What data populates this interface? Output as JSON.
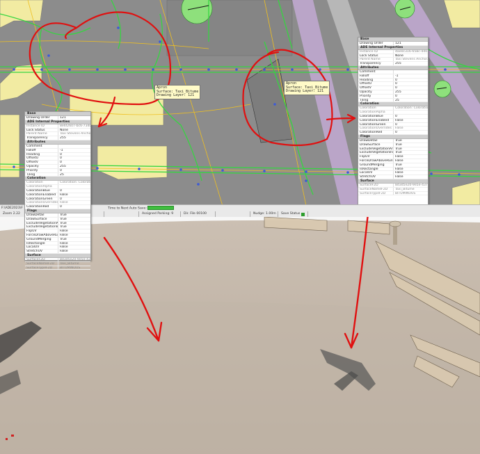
{
  "map_labels": {
    "left": {
      "line1": "Apron",
      "line2": "Surface: Taxi_Bitume",
      "line3": "Drawing Layer: 121"
    },
    "right": {
      "line1": "Apron",
      "line2": "Surface: Taxi_Bitume",
      "line3": "Drawing Layer: 121"
    }
  },
  "left_panel": {
    "rows": [
      {
        "type": "section",
        "label": "Base"
      },
      {
        "k": "Drawing Order",
        "v": "121"
      },
      {
        "type": "section",
        "label": "ADE Internal Properties"
      },
      {
        "k": "Instance ID",
        "v": "8e6f2607-bc6-7340a...",
        "gray": true
      },
      {
        "k": "Lock Status",
        "v": "None"
      },
      {
        "k": "Parent Name",
        "v": "Taxi Stevens Anchor...",
        "gray": true
      },
      {
        "k": "Transparency",
        "v": "255"
      },
      {
        "type": "section",
        "label": "Attributes"
      },
      {
        "k": "Comment",
        "v": ""
      },
      {
        "k": "Falloff",
        "v": "-1"
      },
      {
        "k": "Heading",
        "v": "0"
      },
      {
        "k": "OffsetU",
        "v": "0"
      },
      {
        "k": "OffsetV",
        "v": "0"
      },
      {
        "k": "Opacity",
        "v": "255"
      },
      {
        "k": "Priority",
        "v": "0"
      },
      {
        "k": "Tiling",
        "v": "25"
      },
      {
        "type": "section",
        "label": "Coloration"
      },
      {
        "k": "Coloration",
        "v": "Coloration: Coloration",
        "gray": true
      },
      {
        "k": "ColorationAlpha",
        "v": "",
        "gray": true
      },
      {
        "k": "ColorationBlue",
        "v": "0"
      },
      {
        "k": "ColorationEnabled",
        "v": "False"
      },
      {
        "k": "ColorationGreen",
        "v": "0"
      },
      {
        "k": "ColorationOverrides",
        "v": "False",
        "gray": true
      },
      {
        "k": "ColorationRed",
        "v": "0"
      },
      {
        "type": "section",
        "label": "Flags"
      },
      {
        "k": "DrawDetail",
        "v": "True"
      },
      {
        "k": "DrawSurface",
        "v": "True"
      },
      {
        "k": "ExcludeVegetationArou...",
        "v": "True"
      },
      {
        "k": "ExcludeVegetationInside",
        "v": "True"
      },
      {
        "k": "FlipUV",
        "v": "False"
      },
      {
        "k": "ForceDrawAboveRunway",
        "v": "False"
      },
      {
        "k": "GroundMerging",
        "v": "True"
      },
      {
        "k": "IsRectangle",
        "v": "False"
      },
      {
        "k": "LocalUV",
        "v": "False"
      },
      {
        "k": "StretchUV",
        "v": "False"
      },
      {
        "type": "section",
        "label": "Surface"
      },
      {
        "k": "SurfaceF2D",
        "v": "8d3d5e20-9e5e-437...",
        "gray": true
      },
      {
        "k": "SurfaceNameF2D",
        "v": "Taxi_Bitume",
        "gray": true
      },
      {
        "k": "SurfaceTypeF2D",
        "v": "BITUMINOUS",
        "gray": true
      }
    ]
  },
  "right_panel": {
    "rows": [
      {
        "type": "section",
        "label": "Base"
      },
      {
        "k": "Drawing Order",
        "v": "121"
      },
      {
        "type": "section",
        "label": "ADE Internal Properties"
      },
      {
        "k": "Instance ID",
        "v": "4ae0c316-658c-440...",
        "gray": true
      },
      {
        "k": "Lock Status",
        "v": "None"
      },
      {
        "k": "Parent Name",
        "v": "Taxi Stevens Anchor...",
        "gray": true
      },
      {
        "k": "Transparency",
        "v": "255"
      },
      {
        "type": "section",
        "label": "Attributes"
      },
      {
        "k": "Comment",
        "v": ""
      },
      {
        "k": "Falloff",
        "v": "-1"
      },
      {
        "k": "Heading",
        "v": "0"
      },
      {
        "k": "OffsetU",
        "v": "0"
      },
      {
        "k": "OffsetV",
        "v": "0"
      },
      {
        "k": "Opacity",
        "v": "255"
      },
      {
        "k": "Priority",
        "v": "0"
      },
      {
        "k": "Tiling",
        "v": "25"
      },
      {
        "type": "section",
        "label": "Coloration"
      },
      {
        "k": "Coloration",
        "v": "Coloration: Coloration",
        "gray": true
      },
      {
        "k": "ColorationAlpha",
        "v": "",
        "gray": true
      },
      {
        "k": "ColorationBlue",
        "v": "0"
      },
      {
        "k": "ColorationEnabled",
        "v": "False"
      },
      {
        "k": "ColorationGreen",
        "v": "0"
      },
      {
        "k": "ColorationOverrides",
        "v": "False",
        "gray": true
      },
      {
        "k": "ColorationRed",
        "v": "0"
      },
      {
        "type": "section",
        "label": "Flags"
      },
      {
        "k": "DrawDetail",
        "v": "True"
      },
      {
        "k": "DrawSurface",
        "v": "True"
      },
      {
        "k": "ExcludeVegetationArou...",
        "v": "True"
      },
      {
        "k": "ExcludeVegetationInside",
        "v": "True"
      },
      {
        "k": "FlipUV",
        "v": "False"
      },
      {
        "k": "ForceDrawAboveRunway",
        "v": "False"
      },
      {
        "k": "GroundMerging",
        "v": "True"
      },
      {
        "k": "IsRectangle",
        "v": "False"
      },
      {
        "k": "LocalUV",
        "v": "False"
      },
      {
        "k": "StretchUV",
        "v": "False"
      },
      {
        "type": "section",
        "label": "Surface"
      },
      {
        "k": "SurfaceF2D",
        "v": "8d3d5e20-9e5e-437...",
        "gray": true
      },
      {
        "k": "SurfaceNameF2D",
        "v": "Taxi_Bitume",
        "gray": true
      },
      {
        "k": "SurfaceTypeF2D",
        "v": "BITUMINOUS",
        "gray": true
      }
    ]
  },
  "status": {
    "path": "F:\\ADE2023\\F",
    "zoom": "Zoom 2.22",
    "autosave_label": "Time to Next Auto Save:",
    "autosave_progress": 1.0,
    "assigned_parking": "Assigned Parking: 9",
    "dir_file": "Dir. File 00100",
    "nudge": "Nudge: 1.00m",
    "save_status": "Save Status"
  },
  "colors": {
    "annotation_red": "#e01010",
    "taxiway_green": "#35d640",
    "node_blue": "#3c5ad8",
    "taxi_line_yellow": "#f0c020",
    "building_fill": "#f2eba2",
    "runway_purple": "#b48cc8"
  }
}
